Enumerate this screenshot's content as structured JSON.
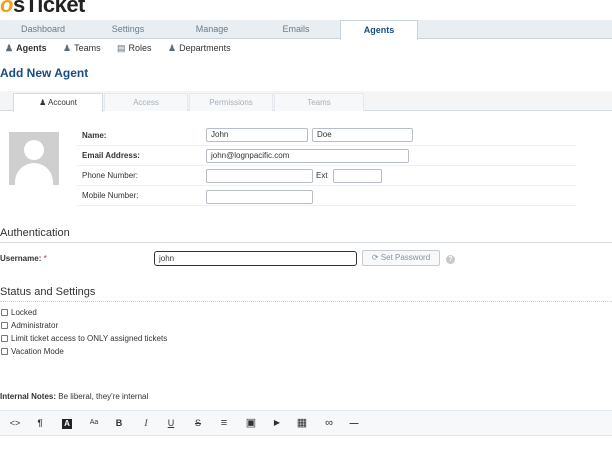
{
  "logo": {
    "prefix": "o",
    "text": "sTicket"
  },
  "nav": {
    "tabs": [
      {
        "label": "Dashboard",
        "active": false
      },
      {
        "label": "Settings",
        "active": false
      },
      {
        "label": "Manage",
        "active": false
      },
      {
        "label": "Emails",
        "active": false
      },
      {
        "label": "Agents",
        "active": true
      }
    ]
  },
  "subnav": {
    "items": [
      {
        "label": "Agents",
        "icon": "user-icon",
        "active": true
      },
      {
        "label": "Teams",
        "icon": "users-icon",
        "active": false
      },
      {
        "label": "Roles",
        "icon": "list-icon",
        "active": false
      },
      {
        "label": "Departments",
        "icon": "department-icon",
        "active": false
      }
    ]
  },
  "page_title": "Add New Agent",
  "tabs": [
    {
      "label": "Account",
      "icon": "user-icon",
      "active": true
    },
    {
      "label": "Access",
      "active": false
    },
    {
      "label": "Permissions",
      "active": false
    },
    {
      "label": "Teams",
      "active": false
    }
  ],
  "account": {
    "name_label": "Name:",
    "first_name": "John",
    "last_name": "Doe",
    "email_label": "Email Address:",
    "email": "john@lognpacific.com",
    "phone_label": "Phone Number:",
    "ext_label": "Ext",
    "mobile_label": "Mobile Number:"
  },
  "authentication": {
    "heading": "Authentication",
    "username_label": "Username:",
    "required_mark": "*",
    "username": "john",
    "set_password_label": "Set Password",
    "help": "?"
  },
  "status": {
    "heading": "Status and Settings",
    "options": [
      {
        "label": "Locked",
        "checked": false
      },
      {
        "label": "Administrator",
        "checked": false
      },
      {
        "label": "Limit ticket access to ONLY assigned tickets",
        "checked": false
      },
      {
        "label": "Vacation Mode",
        "checked": false
      }
    ]
  },
  "notes": {
    "label": "Internal Notes:",
    "hint": "Be liberal, they're internal"
  },
  "editor_toolbar": {
    "buttons": [
      {
        "name": "code-icon",
        "glyph": "<>"
      },
      {
        "name": "paragraph-icon",
        "glyph": "¶"
      },
      {
        "name": "text-color-icon",
        "glyph": "A"
      },
      {
        "name": "font-size-icon",
        "glyph": "Aa"
      },
      {
        "name": "bold-icon",
        "glyph": "B"
      },
      {
        "name": "italic-icon",
        "glyph": "I"
      },
      {
        "name": "underline-icon",
        "glyph": "U"
      },
      {
        "name": "strikethrough-icon",
        "glyph": "S"
      },
      {
        "name": "list-icon",
        "glyph": "≡"
      },
      {
        "name": "image-icon",
        "glyph": "▣"
      },
      {
        "name": "video-icon",
        "glyph": "▶"
      },
      {
        "name": "table-icon",
        "glyph": "▦"
      },
      {
        "name": "link-icon",
        "glyph": "∞"
      },
      {
        "name": "horizontal-rule-icon",
        "glyph": "—"
      }
    ]
  },
  "colors": {
    "accent": "#184e81",
    "logo_orange": "#f2a01a",
    "nav_bg": "#e9eef2"
  }
}
